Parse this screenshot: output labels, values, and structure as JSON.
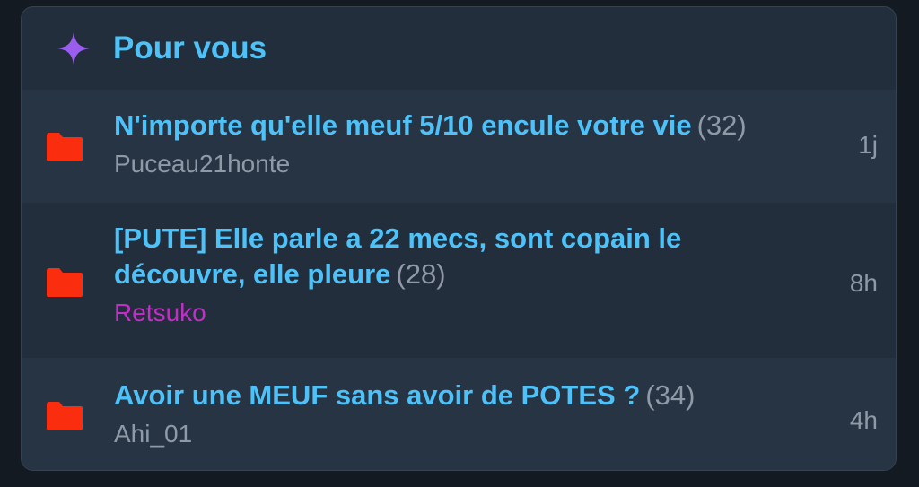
{
  "widget": {
    "title": "Pour vous",
    "accent_color": "#4ec2f8",
    "icon": "sparkle-icon"
  },
  "topics": [
    {
      "title": "N'importe qu'elle meuf 5/10 encule votre vie",
      "count": "(32)",
      "author": "Puceau21honte",
      "time": "1j",
      "icon": "folder-icon"
    },
    {
      "title": "[PUTE] Elle parle a 22 mecs, sont copain le découvre, elle pleure",
      "count": "(28)",
      "author": "Retsuko",
      "author_color": "#c02fc6",
      "time": "8h",
      "icon": "folder-icon"
    },
    {
      "title": "Avoir une MEUF sans avoir de POTES ?",
      "count": "(34)",
      "author": "Ahi_01",
      "time": "4h",
      "icon": "folder-icon"
    }
  ]
}
